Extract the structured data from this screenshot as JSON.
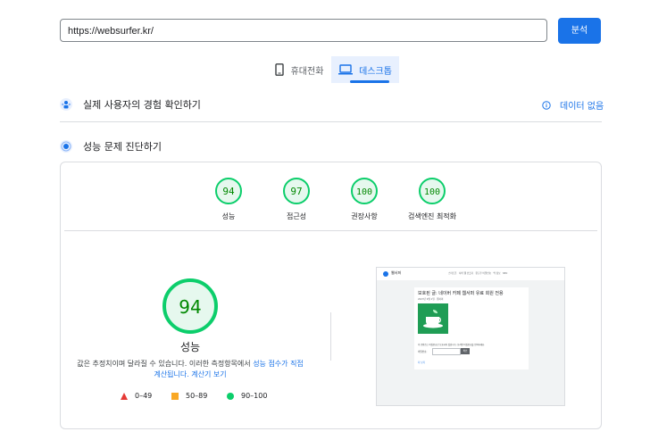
{
  "url_input": {
    "value": "https://websurfer.kr/"
  },
  "analyze_button": "분석",
  "device_tabs": [
    {
      "label": "휴대전화",
      "icon": "phone-icon",
      "active": false
    },
    {
      "label": "데스크톱",
      "icon": "desktop-icon",
      "active": true
    }
  ],
  "field_data": {
    "title": "실제 사용자의 경험 확인하기",
    "no_data_label": "데이터 없음"
  },
  "diagnose": {
    "title": "성능 문제 진단하기"
  },
  "score_summary": [
    {
      "score": 94,
      "label": "성능"
    },
    {
      "score": 97,
      "label": "접근성"
    },
    {
      "score": 100,
      "label": "권장사항"
    },
    {
      "score": 100,
      "label": "검색엔진 최적화"
    }
  ],
  "performance": {
    "score": 94,
    "label": "성능",
    "note_prefix": "값은 추정치이며 달라질 수 있습니다. 이러한 측정항목에서 ",
    "note_link": "성능 점수가 직접 계산됩니다.",
    "note_link2": "계산기 보기"
  },
  "legend": [
    {
      "range": "0–49",
      "color": "#e53935",
      "shape": "triangle"
    },
    {
      "range": "50–89",
      "color": "#f9a825",
      "shape": "square"
    },
    {
      "range": "90–100",
      "color": "#0cce6b",
      "shape": "circle"
    }
  ],
  "colors": {
    "accent": "#1a73e8",
    "pass": "#0cce6b"
  },
  "preview": {
    "site_name": "웹서퍼",
    "nav": [
      "스마트폰",
      "서버 웹 인프라",
      "윈도우 비밀번호",
      "맥 정보",
      "SEO"
    ],
    "post_title": "보호된 글: 네이버 카페 웹서퍼 유료 회원 전용",
    "post_meta": "2023년 9월 1일 · 웹서퍼",
    "body_text": "이 콘텐츠는 비밀번호로 보호되어 있습니다. 보려면 비밀번호를 입력하세요.",
    "password_label": "비밀번호:",
    "submit_label": "확인",
    "footer_link": "더 보기"
  }
}
